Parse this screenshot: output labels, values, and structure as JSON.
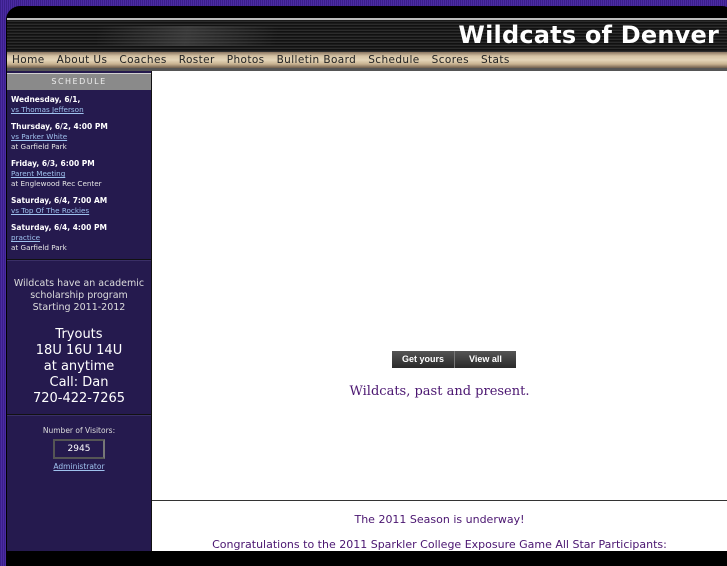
{
  "site": {
    "title": "Wildcats of Denver"
  },
  "nav": {
    "items": [
      "Home",
      "About Us",
      "Coaches",
      "Roster",
      "Photos",
      "Bulletin Board",
      "Schedule",
      "Scores",
      "Stats"
    ]
  },
  "sidebar": {
    "schedule_heading": "SCHEDULE",
    "events": [
      {
        "when": "Wednesday, 6/1,",
        "link": "vs Thomas Jefferson",
        "where": ""
      },
      {
        "when": "Thursday, 6/2, 4:00 PM",
        "link": "vs Parker White",
        "where": "at Garfield Park"
      },
      {
        "when": "Friday, 6/3, 6:00 PM",
        "link": "Parent Meeting",
        "where": "at Englewood Rec Center"
      },
      {
        "when": "Saturday, 6/4, 7:00 AM",
        "link": "vs Top Of The Rockies",
        "where": ""
      },
      {
        "when": "Saturday, 6/4, 4:00 PM",
        "link": "practice",
        "where": "at Garfield Park"
      }
    ],
    "promo": [
      "Wildcats have an academic",
      "scholarship program",
      "Starting 2011-2012"
    ],
    "tryouts": [
      "Tryouts",
      "18U 16U 14U",
      "at anytime",
      "Call: Dan",
      "720-422-7265"
    ],
    "visitors_label": "Number of Visitors:",
    "visitors_count": "2945",
    "admin_link": "Administrator"
  },
  "main": {
    "buttons": [
      "Get yours",
      "View all"
    ],
    "tagline": "Wildcats, past and present.",
    "news_heading": "The 2011 Season is underway!",
    "news_line": "Congratulations to the 2011 Sparkler College Exposure Game All Star Participants:"
  }
}
